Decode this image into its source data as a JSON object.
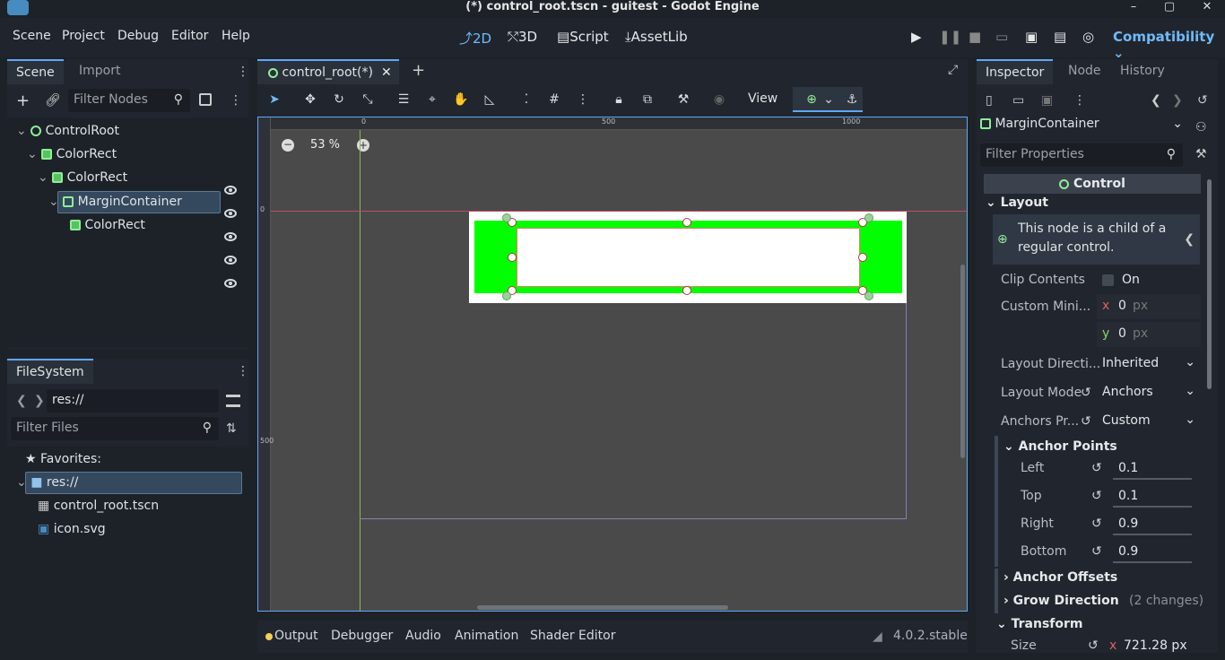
{
  "title": "(*) control_root.tscn - guitest - Godot Engine",
  "menu": {
    "items": [
      "Scene",
      "Project",
      "Debug",
      "Editor",
      "Help"
    ]
  },
  "workspaces": {
    "w2d": "2D",
    "w3d": "3D",
    "script": "Script",
    "assetlib": "AssetLib"
  },
  "renderer": "Compatibility",
  "scene_dock": {
    "tab_scene": "Scene",
    "tab_import": "Import",
    "filter_placeholder": "Filter Nodes",
    "nodes": [
      "ControlRoot",
      "ColorRect",
      "ColorRect",
      "MarginContainer",
      "ColorRect"
    ]
  },
  "filesystem": {
    "tab": "FileSystem",
    "path": "res://",
    "filter_placeholder": "Filter Files",
    "favorites": "Favorites:",
    "root": "res://",
    "files": [
      "control_root.tscn",
      "icon.svg"
    ]
  },
  "editor": {
    "tab": "control_root(*)",
    "zoom": "53 %",
    "view_menu": "View",
    "ruler_top": [
      "0",
      "500",
      "1000"
    ],
    "ruler_left": [
      "0",
      "500"
    ]
  },
  "inspector": {
    "tab_inspector": "Inspector",
    "tab_node": "Node",
    "tab_history": "History",
    "node_type": "MarginContainer",
    "filter_placeholder": "Filter Properties",
    "class_header": "Control",
    "section_layout": "Layout",
    "info": "This node is a child of a regular control.",
    "clip_label": "Clip Contents",
    "clip_value": "On",
    "custom_min_label": "Custom Mini...",
    "cm_x_axis": "x",
    "cm_x": "0",
    "cm_y_axis": "y",
    "cm_y": "0",
    "px": "px",
    "layout_dir_label": "Layout Directi...",
    "layout_dir": "Inherited",
    "layout_mode_label": "Layout Mode",
    "layout_mode": "Anchors",
    "anchors_preset_label": "Anchors Pr...",
    "anchors_preset": "Custom",
    "anchor_points": "Anchor Points",
    "left_label": "Left",
    "left": "0.1",
    "top_label": "Top",
    "top": "0.1",
    "right_label": "Right",
    "right": "0.9",
    "bottom_label": "Bottom",
    "bottom": "0.9",
    "anchor_offsets": "Anchor Offsets",
    "grow_direction": "Grow Direction",
    "grow_changes": "(2 changes)",
    "transform": "Transform",
    "size_label": "Size",
    "size_axis": "x",
    "size_value": "721.28 px"
  },
  "bottom": {
    "output": "Output",
    "debugger": "Debugger",
    "audio": "Audio",
    "animation": "Animation",
    "shader": "Shader Editor",
    "version": "4.0.2.stable"
  },
  "colors": {
    "accent": "#70bafa",
    "green": "#00ff00",
    "selection": "#34495e"
  }
}
